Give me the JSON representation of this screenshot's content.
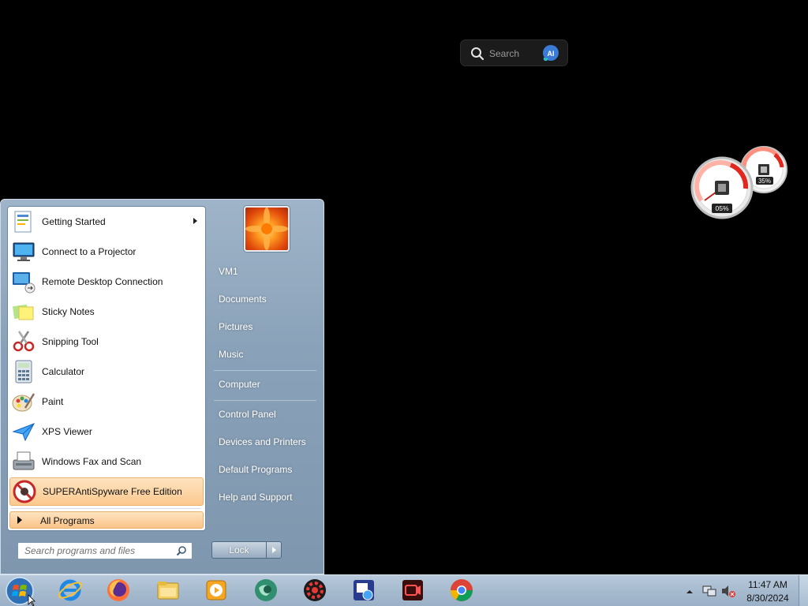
{
  "desktop": {
    "search_widget": {
      "placeholder": "Search",
      "ai_label": "AI"
    },
    "gauge": {
      "cpu_value": "05%",
      "memory_value": "35%"
    }
  },
  "start_menu": {
    "programs": [
      {
        "label": "Getting Started",
        "icon": "getting-started-icon",
        "has_submenu": true
      },
      {
        "label": "Connect to a Projector",
        "icon": "projector-icon"
      },
      {
        "label": "Remote Desktop Connection",
        "icon": "remote-desktop-icon"
      },
      {
        "label": "Sticky Notes",
        "icon": "sticky-notes-icon"
      },
      {
        "label": "Snipping Tool",
        "icon": "snipping-tool-icon"
      },
      {
        "label": "Calculator",
        "icon": "calculator-icon"
      },
      {
        "label": "Paint",
        "icon": "paint-icon"
      },
      {
        "label": "XPS Viewer",
        "icon": "xps-viewer-icon"
      },
      {
        "label": "Windows Fax and Scan",
        "icon": "fax-scan-icon"
      },
      {
        "label": "SUPERAntiSpyware Free Edition",
        "icon": "superantispyware-icon",
        "highlighted": true
      }
    ],
    "all_programs_label": "All Programs",
    "search_placeholder": "Search programs and files",
    "right_items": {
      "user": "VM1",
      "documents": "Documents",
      "pictures": "Pictures",
      "music": "Music",
      "computer": "Computer",
      "control_panel": "Control Panel",
      "devices_printers": "Devices and Printers",
      "default_programs": "Default Programs",
      "help_support": "Help and Support"
    },
    "shutdown_label": "Lock"
  },
  "taskbar": {
    "pinned": [
      "internet-explorer-icon",
      "firefox-icon",
      "file-explorer-icon",
      "media-player-icon",
      "globe-app-icon",
      "red-gear-app-icon",
      "image-tool-icon",
      "screen-recorder-icon",
      "chrome-icon"
    ],
    "clock": {
      "time": "11:47 AM",
      "date": "8/30/2024"
    }
  },
  "colors": {
    "highlight": "#fcc98e",
    "taskbar": "#a7bbcf",
    "start_menu_frame": "#8aa2b9"
  }
}
